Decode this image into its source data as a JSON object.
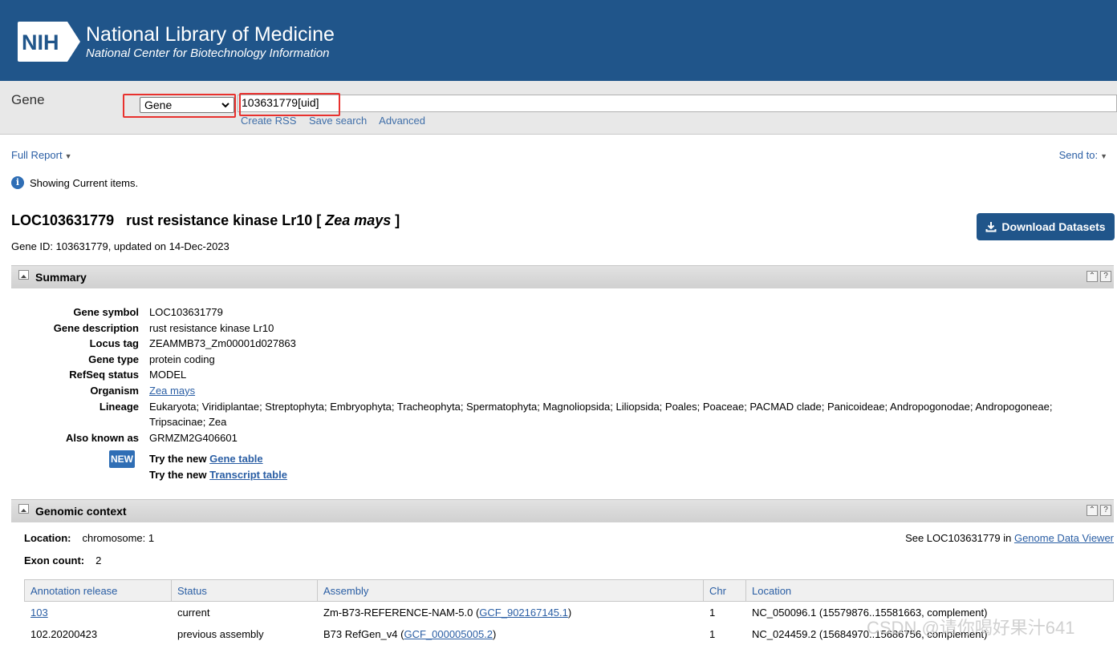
{
  "header": {
    "logo_text": "NIH",
    "title": "National Library of Medicine",
    "subtitle": "National Center for Biotechnology Information"
  },
  "search": {
    "db_label": "Gene",
    "db_selected": "Gene",
    "query": "103631779[uid]",
    "links": [
      "Create RSS",
      "Save search",
      "Advanced"
    ]
  },
  "report": {
    "full_report": "Full Report",
    "send_to": "Send to:",
    "info_text": "Showing Current items."
  },
  "gene": {
    "title_prefix": "LOC103631779   rust resistance kinase Lr10 [ ",
    "organism_italic": "Zea mays",
    "title_suffix": " ]",
    "id_line": "Gene ID: 103631779, updated on 14-Dec-2023",
    "download_label": "Download Datasets"
  },
  "summary": {
    "section_title": "Summary",
    "rows": [
      {
        "label": "Gene symbol",
        "value": "LOC103631779"
      },
      {
        "label": "Gene description",
        "value": "rust resistance kinase Lr10"
      },
      {
        "label": "Locus tag",
        "value": "ZEAMMB73_Zm00001d027863"
      },
      {
        "label": "Gene type",
        "value": "protein coding"
      },
      {
        "label": "RefSeq status",
        "value": "MODEL"
      },
      {
        "label": "Organism",
        "value": "Zea mays"
      },
      {
        "label": "Lineage",
        "value": "Eukaryota; Viridiplantae; Streptophyta; Embryophyta; Tracheophyta; Spermatophyta; Magnoliopsida; Liliopsida; Poales; Poaceae; PACMAD clade; Panicoideae; Andropogonodae; Andropogoneae; Tripsacinae; Zea"
      },
      {
        "label": "Also known as",
        "value": "GRMZM2G406601"
      }
    ],
    "new_badge": "NEW",
    "try_prefix": "Try the new ",
    "gene_table_link": "Gene table",
    "transcript_table_link": "Transcript table"
  },
  "genomic": {
    "section_title": "Genomic context",
    "location_label": "Location:",
    "location_value": "chromosome: 1",
    "exon_label": "Exon count:",
    "exon_value": "2",
    "see_prefix": "See LOC103631779 in ",
    "see_link": "Genome Data Viewer",
    "table": {
      "headers": [
        "Annotation release",
        "Status",
        "Assembly",
        "Chr",
        "Location"
      ],
      "rows": [
        {
          "release": "103",
          "status": "current",
          "assembly_prefix": "Zm-B73-REFERENCE-NAM-5.0 (",
          "assembly_link": "GCF_902167145.1",
          "assembly_suffix": ")",
          "chr": "1",
          "location": "NC_050096.1 (15579876..15581663, complement)"
        },
        {
          "release": "102.20200423",
          "status": "previous assembly",
          "assembly_prefix": "B73 RefGen_v4 (",
          "assembly_link": "GCF_000005005.2",
          "assembly_suffix": ")",
          "chr": "1",
          "location": "NC_024459.2 (15684970..15686756, complement)"
        }
      ]
    }
  },
  "watermark": "CSDN @请你喝好果汁641",
  "colors": {
    "header_bg": "#20558a",
    "link": "#2a5ea4",
    "highlight_red": "#e8312e"
  }
}
